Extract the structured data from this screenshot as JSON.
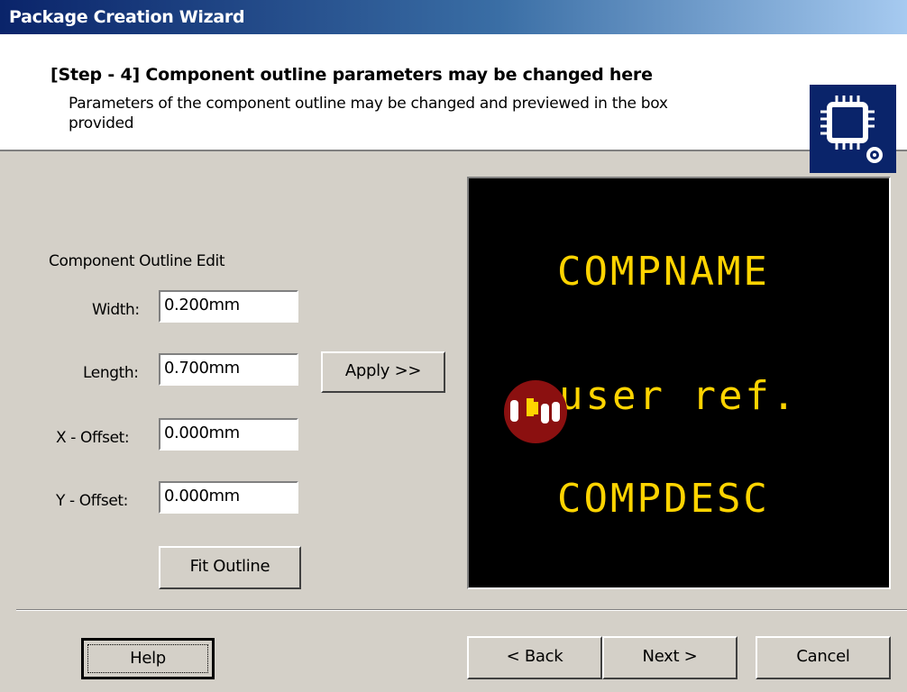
{
  "window": {
    "title": "Package Creation Wizard"
  },
  "header": {
    "step_title": "[Step - 4] Component outline parameters may be changed here",
    "description": "Parameters of the component outline may be changed and previewed in the box provided",
    "logo_icon": "chip-icon"
  },
  "outline_edit": {
    "section_label": "Component Outline Edit",
    "width_label": "Width:",
    "width_value": "0.200mm",
    "length_label": "Length:",
    "length_value": "0.700mm",
    "xoffset_label": "X - Offset:",
    "xoffset_value": "0.000mm",
    "yoffset_label": "Y - Offset:",
    "yoffset_value": "0.000mm",
    "apply_label": "Apply >>",
    "fit_label": "Fit Outline"
  },
  "preview": {
    "compname": "COMPNAME",
    "userref": "user ref.",
    "compdesc": "COMPDESC",
    "text_color": "#ffd400",
    "pad_color": "#8b1010"
  },
  "footer": {
    "help": "Help",
    "back": "< Back",
    "next": "Next >",
    "cancel": "Cancel"
  }
}
